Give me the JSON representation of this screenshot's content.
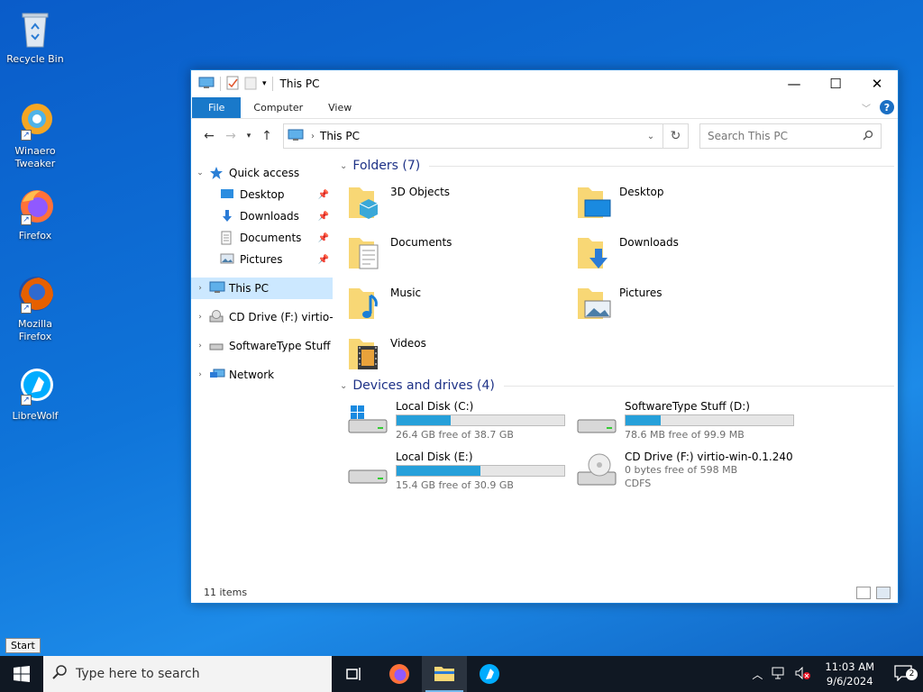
{
  "desktop": {
    "icons": [
      {
        "label": "Recycle Bin",
        "icon": "recycle-bin-icon"
      },
      {
        "label": "Winaero Tweaker",
        "icon": "winaero-tweaker-icon"
      },
      {
        "label": "Firefox",
        "icon": "firefox-icon"
      },
      {
        "label": "Mozilla Firefox",
        "icon": "mozilla-firefox-icon"
      },
      {
        "label": "LibreWolf",
        "icon": "librewolf-icon"
      }
    ]
  },
  "window": {
    "title": "This PC",
    "ribbon_tabs": {
      "file": "File",
      "computer": "Computer",
      "view": "View"
    },
    "help_label": "?",
    "address": {
      "crumb": "This PC"
    },
    "search": {
      "placeholder": "Search This PC"
    },
    "nav": {
      "quick_access": "Quick access",
      "quick_items": [
        {
          "label": "Desktop"
        },
        {
          "label": "Downloads"
        },
        {
          "label": "Documents"
        },
        {
          "label": "Pictures"
        }
      ],
      "this_pc": "This PC",
      "cd_drive": "CD Drive (F:) virtio-w",
      "software": "SoftwareType Stuff (D",
      "network": "Network"
    },
    "folders_header": "Folders (7)",
    "folders": [
      {
        "name": "3D Objects"
      },
      {
        "name": "Desktop"
      },
      {
        "name": "Documents"
      },
      {
        "name": "Downloads"
      },
      {
        "name": "Music"
      },
      {
        "name": "Pictures"
      },
      {
        "name": "Videos"
      }
    ],
    "drives_header": "Devices and drives (4)",
    "drives": [
      {
        "name": "Local Disk (C:)",
        "free": "26.4 GB free of 38.7 GB",
        "used_fraction": 0.32
      },
      {
        "name": "SoftwareType Stuff (D:)",
        "free": "78.6 MB free of 99.9 MB",
        "used_fraction": 0.21
      },
      {
        "name": "Local Disk (E:)",
        "free": "15.4 GB free of 30.9 GB",
        "used_fraction": 0.5
      },
      {
        "name": "CD Drive (F:) virtio-win-0.1.240",
        "free": "0 bytes free of 598 MB",
        "fs": "CDFS"
      }
    ],
    "status": "11 items"
  },
  "taskbar": {
    "search_placeholder": "Type here to search",
    "start_tooltip": "Start",
    "time": "11:03 AM",
    "date": "9/6/2024",
    "notification_count": "2"
  },
  "colors": {
    "accent": "#1979ca",
    "bar_fill": "#26a0da",
    "selection": "#cce8ff",
    "group_header": "#1e3287"
  }
}
